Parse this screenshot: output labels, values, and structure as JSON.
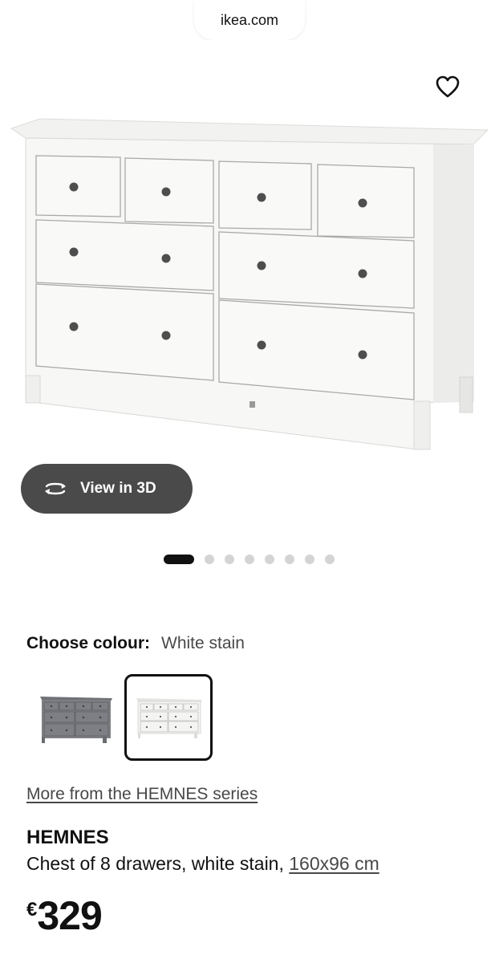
{
  "browser": {
    "url_label": "ikea.com"
  },
  "hero": {
    "favourite_icon": "heart-outline-icon",
    "view3d_label": "View in 3D",
    "view3d_icon": "rotate-3d-icon",
    "carousel": {
      "total": 8,
      "active_index": 0
    }
  },
  "colour": {
    "label": "Choose colour:",
    "selected": "White stain",
    "options": [
      {
        "name": "grey-stain",
        "color": "#7d7f84",
        "selected": false
      },
      {
        "name": "white-stain",
        "color": "#f4f4f2",
        "selected": true
      }
    ]
  },
  "series_link": "More from the HEMNES series",
  "product": {
    "name": "HEMNES",
    "description": "Chest of 8 drawers, white stain, ",
    "size": "160x96 cm",
    "currency": "€",
    "price": "329"
  }
}
